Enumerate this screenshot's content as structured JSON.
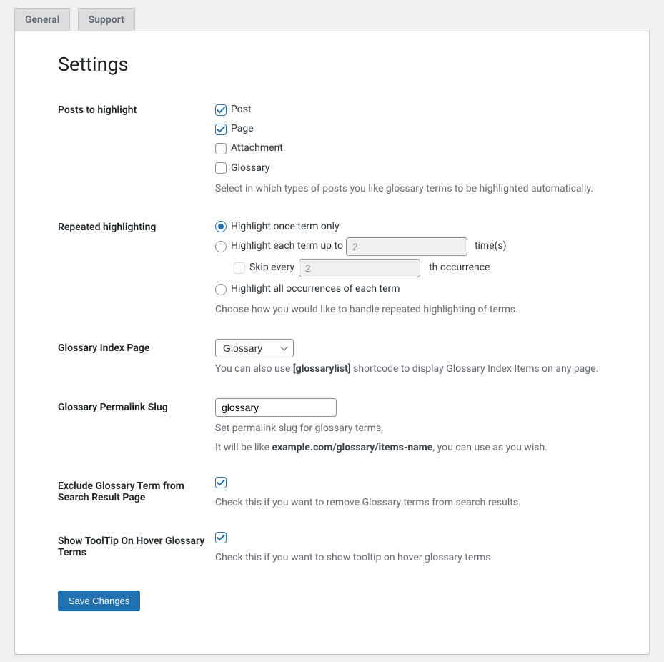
{
  "tabs": {
    "general": "General",
    "support": "Support"
  },
  "heading": "Settings",
  "rows": {
    "postsToHighlight": {
      "label": "Posts to highlight",
      "options": {
        "post": {
          "label": "Post",
          "checked": true
        },
        "page": {
          "label": "Page",
          "checked": true
        },
        "attachment": {
          "label": "Attachment",
          "checked": false
        },
        "glossary": {
          "label": "Glossary",
          "checked": false
        }
      },
      "desc": "Select in which types of posts you like glossary terms to be highlighted automatically."
    },
    "repeated": {
      "label": "Repeated highlighting",
      "once": "Highlight once term only",
      "eachPre": "Highlight each term up to",
      "eachPost": "time(s)",
      "upToValue": "2",
      "skipPre": "Skip every",
      "skipPost": "th occurrence",
      "skipValue": "2",
      "all": "Highlight all occurrences of each term",
      "desc": "Choose how you would like to handle repeated highlighting of terms."
    },
    "indexPage": {
      "label": "Glossary Index Page",
      "selected": "Glossary",
      "descPre": "You can also use ",
      "descBold": "[glossarylist]",
      "descPost": " shortcode to display Glossary Index Items on any page."
    },
    "slug": {
      "label": "Glossary Permalink Slug",
      "value": "glossary",
      "desc1": "Set permalink slug for glossary terms,",
      "desc2pre": "It will be like ",
      "desc2bold": "example.com/glossary/items-name",
      "desc2post": ", you can use as you wish."
    },
    "exclude": {
      "label": "Exclude Glossary Term from Search Result Page",
      "checked": true,
      "desc": "Check this if you want to remove Glossary terms from search results."
    },
    "tooltip": {
      "label": "Show ToolTip On Hover Glossary Terms",
      "checked": true,
      "desc": "Check this if you want to show tooltip on hover glossary terms."
    }
  },
  "saveButton": "Save Changes"
}
